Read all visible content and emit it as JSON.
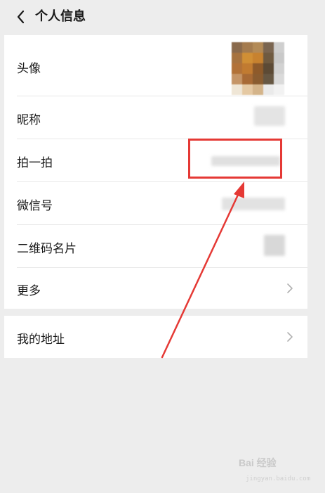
{
  "header": {
    "title": "个人信息",
    "back_icon": "chevron-left-icon"
  },
  "rows": {
    "avatar": {
      "label": "头像"
    },
    "nickname": {
      "label": "昵称"
    },
    "pai_yi_pai": {
      "label": "拍一拍"
    },
    "wechat_id": {
      "label": "微信号"
    },
    "qr_code": {
      "label": "二维码名片"
    },
    "more": {
      "label": "更多",
      "icon": "chevron-right-icon"
    }
  },
  "address": {
    "label": "我的地址",
    "icon": "chevron-right-icon"
  },
  "annotation": {
    "highlight_color": "#e53935",
    "arrow_color": "#e53935"
  },
  "watermark": {
    "text": "Bai 经验",
    "sub": "jingyan.baidu.com"
  }
}
